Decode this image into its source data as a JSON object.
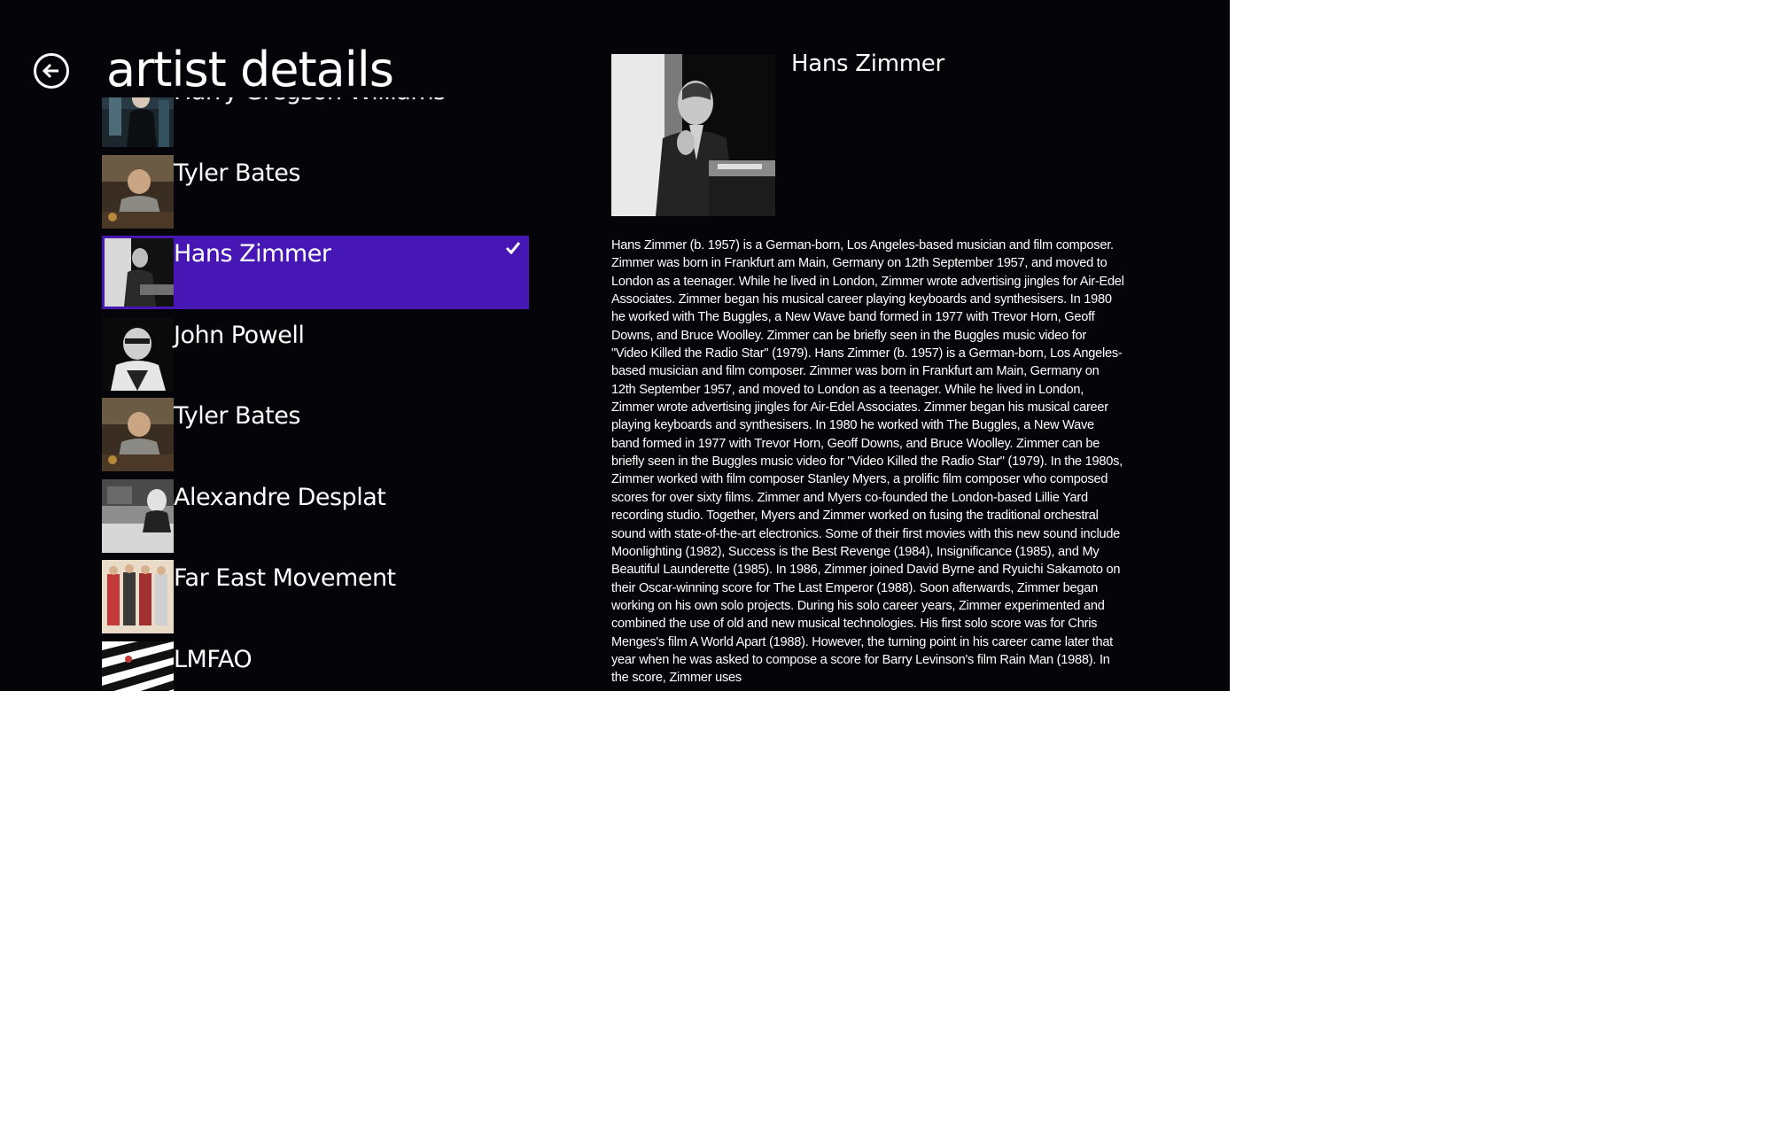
{
  "header": {
    "title": "artist details",
    "back_icon": "back-arrow-icon"
  },
  "colors": {
    "background": "#050409",
    "accent": "#4617b4",
    "text": "#ffffff"
  },
  "artists": [
    {
      "name": "Harry Gregson-Williams",
      "selected": false
    },
    {
      "name": "Tyler Bates",
      "selected": false
    },
    {
      "name": "Hans Zimmer",
      "selected": true
    },
    {
      "name": "John Powell",
      "selected": false
    },
    {
      "name": "Tyler Bates",
      "selected": false
    },
    {
      "name": "Alexandre Desplat",
      "selected": false
    },
    {
      "name": "Far East Movement",
      "selected": false
    },
    {
      "name": "LMFAO",
      "selected": false
    }
  ],
  "detail": {
    "name": "Hans Zimmer",
    "bio": "Hans Zimmer (b. 1957) is a German-born, Los Angeles-based musician and film composer. Zimmer was born in Frankfurt am Main, Germany on 12th September 1957, and moved to London as a teenager. While he lived in London, Zimmer wrote advertising jingles for Air-Edel Associates. Zimmer began his musical career playing keyboards and synthesisers. In 1980 he worked with The Buggles, a New Wave band formed in 1977 with Trevor Horn, Geoff Downs, and Bruce Woolley. Zimmer can be briefly seen in the Buggles music video for \"Video Killed the Radio Star\" (1979). Hans Zimmer (b. 1957) is a German-born, Los Angeles-based musician and film composer. Zimmer was born in Frankfurt am Main, Germany on 12th September 1957, and moved to London as a teenager. While he lived in London, Zimmer wrote advertising jingles for Air-Edel Associates. Zimmer began his musical career playing keyboards and synthesisers. In 1980 he worked with The Buggles, a New Wave band formed in 1977 with Trevor Horn, Geoff Downs, and Bruce Woolley. Zimmer can be briefly seen in the Buggles music video for \"Video Killed the Radio Star\" (1979). In the 1980s, Zimmer worked with film composer Stanley Myers, a prolific film composer who composed scores for over sixty films. Zimmer and Myers co-founded the London-based Lillie Yard recording studio. Together, Myers and Zimmer worked on fusing the traditional orchestral sound with state-of-the-art electronics. Some of their first movies with this new sound include Moonlighting (1982), Success is the Best Revenge (1984), Insignificance (1985), and My Beautiful Launderette (1985). In 1986, Zimmer joined David Byrne and Ryuichi Sakamoto on their Oscar-winning score for The Last Emperor (1988). Soon afterwards, Zimmer began working on his own solo projects. During his solo career years, Zimmer experimented and combined the use of old and new musical technologies. His first solo score was for Chris Menges's film A World Apart (1988). However, the turning point in his career came later that year when he was asked to compose a score for Barry Levinson's film Rain Man (1988). In the score, Zimmer uses"
  }
}
